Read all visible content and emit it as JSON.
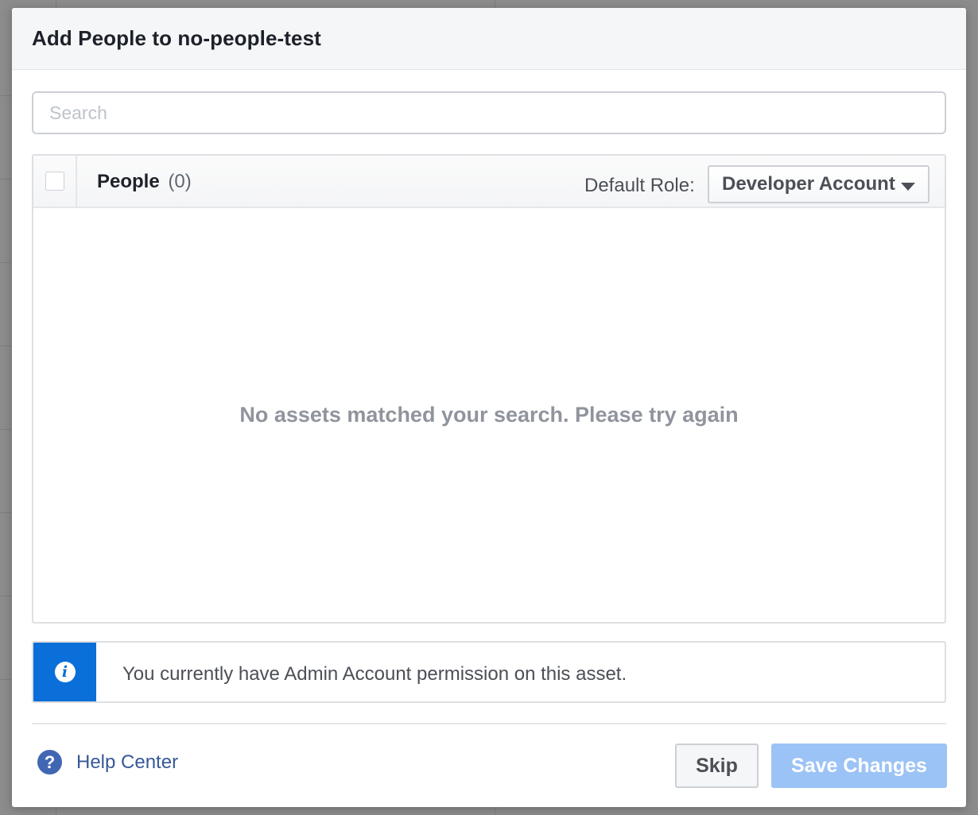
{
  "dialog": {
    "title": "Add People to no-people-test"
  },
  "search": {
    "placeholder": "Search",
    "value": ""
  },
  "table": {
    "heading_label": "People",
    "heading_count": "(0)",
    "default_role_label": "Default Role:",
    "default_role_value": "Developer Account",
    "empty_message": "No assets matched your search. Please try again"
  },
  "info_banner": {
    "icon": "info-icon",
    "text": "You currently have Admin Account permission on this asset."
  },
  "footer": {
    "help_icon": "question-icon",
    "help_label": "Help Center",
    "skip_label": "Skip",
    "save_label": "Save Changes"
  },
  "colors": {
    "info_accent": "#0a6fd8",
    "save_disabled": "#9cc3f5",
    "link": "#365899"
  }
}
